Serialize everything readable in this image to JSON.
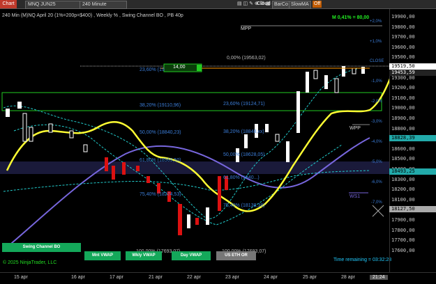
{
  "toolbar": {
    "chart_tab": "Chart",
    "instrument": "MNQ JUN25",
    "timeframe": "240 Minute",
    "cloud_label": "Cloud",
    "barcolor_label": "BarCo",
    "slowma_label": "SlowMA",
    "off_label": "Off"
  },
  "header": {
    "title_left": "240 Min (M)NQ April 20 (1%=200p=$400) , Weekly % , Swing Channel BO , PB 40p",
    "pnl": "M 0,41% = 80,00"
  },
  "price_axis": {
    "labels": [
      "19900,00",
      "19800,00",
      "19700,00",
      "19600,00",
      "19500,00",
      "19400,00",
      "19300,00",
      "19200,00",
      "19100,00",
      "19000,00",
      "18900,00",
      "18800,00",
      "18700,00",
      "18600,00",
      "18500,00",
      "18400,00",
      "18300,00",
      "18200,00",
      "18100,00",
      "18000,00",
      "17900,00",
      "17800,00",
      "17700,00",
      "17600,00"
    ],
    "pct_labels": [
      "+2,0%",
      "+1,0%",
      "CLOSE",
      "-1,0%",
      "-2,0%",
      "-3,0%",
      "-4,0%",
      "-5,0%",
      "-6,0%",
      "-7,0%"
    ],
    "tags": {
      "last": "19519,50",
      "ma": "19453,59",
      "upper": "18828,39",
      "lower": "18493,25",
      "low": "18127,50"
    }
  },
  "annotations": {
    "mpp": "MPP",
    "wpp": "WPP",
    "ws1": "WS1",
    "fib_top": "0,00% (19563,02)",
    "fib_2360_a": "23,60% (19",
    "fib_2360_b": "23,60% (19124,71)",
    "fib_3820_a": "38,20% (19110,96)",
    "fib_3820_b": "38,20% (18848,xx)",
    "fib_50_a": "50,00% (18840,23)",
    "fib_50_b": "50,00% (18628,05)",
    "fib_618_a": "61,80% (18569,50)",
    "fib_618_b": "61,80% (1840...)",
    "fib_75_a": "75,40% (18274,53)",
    "fib_75_b": "75,40% (18138,38)",
    "fib_100_a": "100,00% (17693,07)",
    "fib_100_b": "100,00% (17693,07)",
    "order_qty": "14,00",
    "top_fib_head": "23,60% (19688,00)"
  },
  "buttons": {
    "swing": "Swing Channel BO",
    "mvwap": "Mnt VWAP",
    "wvwap": "Wkly VWAP",
    "dvwap": "Day VWAP",
    "eth": "US ETH OR"
  },
  "footer": {
    "copyright": "© 2025 NinjaTrader, LLC",
    "time_remaining": "Time remaining = 03:32:28",
    "clock": "21:24"
  },
  "date_axis": [
    "15 apr",
    "16 apr",
    "17 apr",
    "21 apr",
    "22 apr",
    "23 apr",
    "24 apr",
    "25 apr",
    "28 apr"
  ],
  "colors": {
    "swing_line": "#ffff33",
    "ma_purple": "#7766dd",
    "cyan_dash": "#22cccc",
    "candle_up": "#ffffff",
    "candle_down": "#dd1111",
    "buy_btn": "#14a85a"
  }
}
